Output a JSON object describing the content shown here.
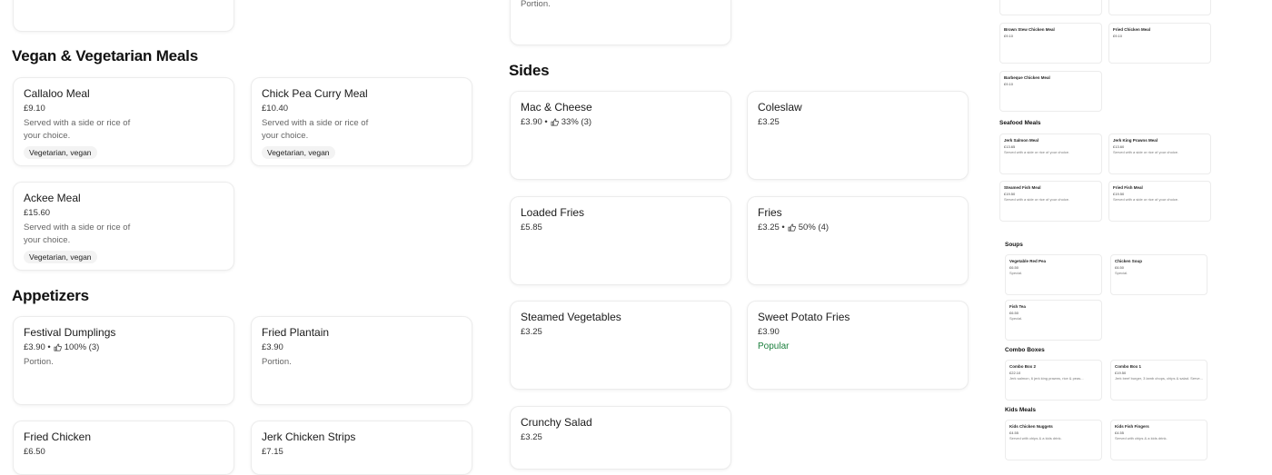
{
  "vegan": {
    "title": "Vegan & Vegetarian Meals",
    "items": [
      {
        "name": "Callaloo Meal",
        "price": "£9.10",
        "desc": "Served with a side or rice of your choice.",
        "tag": "Vegetarian, vegan"
      },
      {
        "name": "Chick Pea Curry Meal",
        "price": "£10.40",
        "desc": "Served with a side or rice of your choice.",
        "tag": "Vegetarian, vegan"
      },
      {
        "name": "Ackee Meal",
        "price": "£15.60",
        "desc": "Served with a side or rice of your choice.",
        "tag": "Vegetarian, vegan"
      }
    ]
  },
  "appetizers": {
    "title": "Appetizers",
    "items": [
      {
        "name": "Festival Dumplings",
        "price": "£3.90 •",
        "rating": "100% (3)",
        "desc": "Portion."
      },
      {
        "name": "Fried Plantain",
        "price": "£3.90",
        "desc": "Portion."
      },
      {
        "name": "Fried Chicken",
        "price": "£6.50"
      },
      {
        "name": "Jerk Chicken Strips",
        "price": "£7.15"
      }
    ]
  },
  "top_portion": {
    "desc": "Portion."
  },
  "sides": {
    "title": "Sides",
    "items": [
      {
        "name": "Mac & Cheese",
        "price": "£3.90 •",
        "rating": "33% (3)"
      },
      {
        "name": "Coleslaw",
        "price": "£3.25"
      },
      {
        "name": "Loaded Fries",
        "price": "£5.85"
      },
      {
        "name": "Fries",
        "price": "£3.25 •",
        "rating": "50% (4)"
      },
      {
        "name": "Steamed Vegetables",
        "price": "£3.25"
      },
      {
        "name": "Sweet Potato Fries",
        "price": "£3.90",
        "badge": "Popular"
      },
      {
        "name": "Crunchy Salad",
        "price": "£3.25"
      }
    ]
  },
  "minimap": {
    "top_items": [
      {
        "name": "Brown Stew Chicken Meal",
        "price": "£9.10"
      },
      {
        "name": "Fried Chicken Meal",
        "price": "£9.10"
      },
      {
        "name": "Barbeque Chicken Meal",
        "price": "£9.10"
      }
    ],
    "seafood": {
      "title": "Seafood Meals",
      "items": [
        {
          "name": "Jerk Salmon Meal",
          "price": "£13.65",
          "desc": "Served with a side or rice of your choice."
        },
        {
          "name": "Jerk King Prawns Meal",
          "price": "£13.60",
          "desc": "Served with a side or rice of your choice."
        },
        {
          "name": "Steamed Fish Meal",
          "price": "£19.50",
          "desc": "Served with a side or rice of your choice."
        },
        {
          "name": "Fried Fish Meal",
          "price": "£19.50",
          "desc": "Served with a side or rice of your choice."
        }
      ]
    },
    "soups": {
      "title": "Soups",
      "items": [
        {
          "name": "Vegetable Red Pea",
          "price": "£6.50",
          "desc": "Special."
        },
        {
          "name": "Chicken Soup",
          "price": "£6.50",
          "desc": "Special."
        },
        {
          "name": "Fish Tea",
          "price": "£6.50",
          "desc": "Special."
        }
      ]
    },
    "combo": {
      "title": "Combo Boxes",
      "items": [
        {
          "name": "Combo Box 2",
          "price": "£22.10",
          "desc": "Jerk salmon, 6 jerk king prawns, rice & peas..."
        },
        {
          "name": "Combo Box 1",
          "price": "£19.50",
          "desc": "Jerk beef burger, 3 lamb chops, chips & salad. Serve..."
        }
      ]
    },
    "kids": {
      "title": "Kids Meals",
      "items": [
        {
          "name": "Kids Chicken Nuggets",
          "price": "£4.55",
          "desc": "Served with chips & a kids drink."
        },
        {
          "name": "Kids Fish Fingers",
          "price": "£4.55",
          "desc": "Served with chips & a kids drink."
        }
      ]
    }
  },
  "colors": {
    "popular": "#1a7f3c",
    "border": "#ececec"
  }
}
